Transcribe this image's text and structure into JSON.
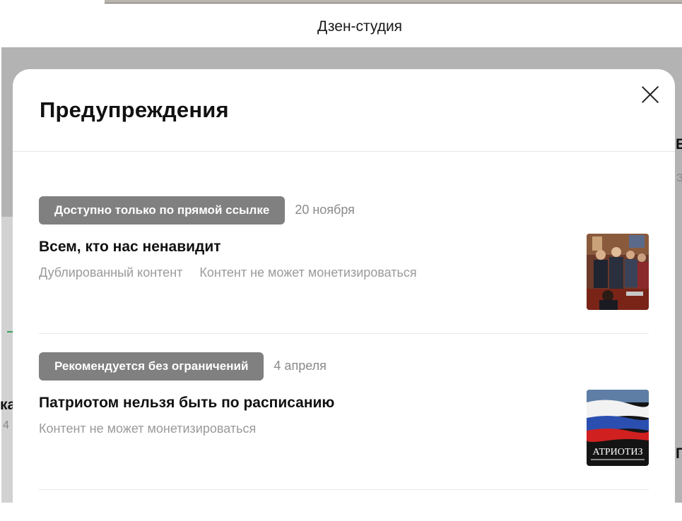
{
  "app": {
    "title": "Дзен-студия"
  },
  "modal": {
    "title": "Предупреждения",
    "items": [
      {
        "status": "Доступно только по прямой ссылке",
        "date": "20 ноября",
        "title": "Всем, кто нас ненавидит",
        "reasons": [
          "Дублированный контент",
          "Контент не может монетизироваться"
        ],
        "thumbnail_icon": "photo-crowd-thumbnail"
      },
      {
        "status": "Рекомендуется без ограничений",
        "date": "4 апреля",
        "title": "Патриотом нельзя быть по расписанию",
        "reasons": [
          "Контент не может монетизироваться"
        ],
        "thumbnail_icon": "russian-flag-thumbnail",
        "thumbnail_text": "АТРИОТИЗ"
      }
    ]
  },
  "background": {
    "fragment_1": "Е",
    "fragment_2": "З",
    "fragment_3": "ка",
    "fragment_4": "4",
    "fragment_5": "Г"
  },
  "colors": {
    "badge": "#808080",
    "overlay": "#b3b3b3",
    "accent_green": "#3aa15c"
  }
}
